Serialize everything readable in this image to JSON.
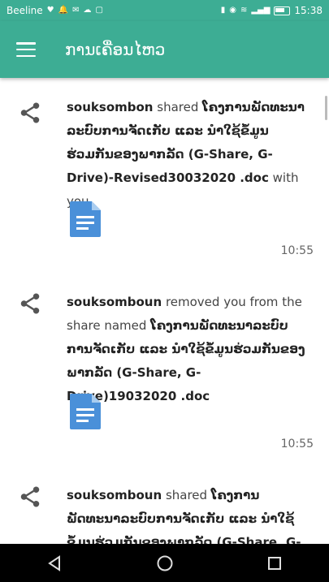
{
  "status_bar": {
    "carrier": "Beeline",
    "time": "15:38"
  },
  "app_bar": {
    "title": "ການເຄື່ອນໄຫວ"
  },
  "activities": [
    {
      "user": "souksombon",
      "action": "shared",
      "target": "ໂຄງການພັດທະນາລະບົບການຈັດເກັບ ແລະ ນໍາໃຊ້ຂໍ້ມູນຮ່ວມກັນຂອງພາກລັດ (G-Share, G-Drive)-Revised30032020 .doc",
      "suffix": "with you",
      "time": "10:55",
      "icon": "document-icon"
    },
    {
      "user": "souksomboun",
      "action": "removed you from the share named",
      "target": "ໂຄງການພັດທະນາລະບົບການຈັດເກັບ ແລະ ນໍາໃຊ້ຂໍ້ມູນຮ່ວມກັນຂອງພາກລັດ (G-Share, G-Drive)19032020 .doc",
      "suffix": "",
      "time": "10:55",
      "icon": "document-icon"
    },
    {
      "user": "souksomboun",
      "action": "shared",
      "target": "ໂຄງການພັດທະນາລະບົບການຈັດເກັບ ແລະ ນໍາໃຊ້ຂໍ້ມູນຮ່ວມກັນຂອງພາກລັດ (G-Share, G-",
      "suffix": "",
      "time": "",
      "icon": "document-icon"
    }
  ],
  "colors": {
    "primary": "#3dad94",
    "doc_icon": "#4a90d9",
    "share_icon": "#555555"
  }
}
